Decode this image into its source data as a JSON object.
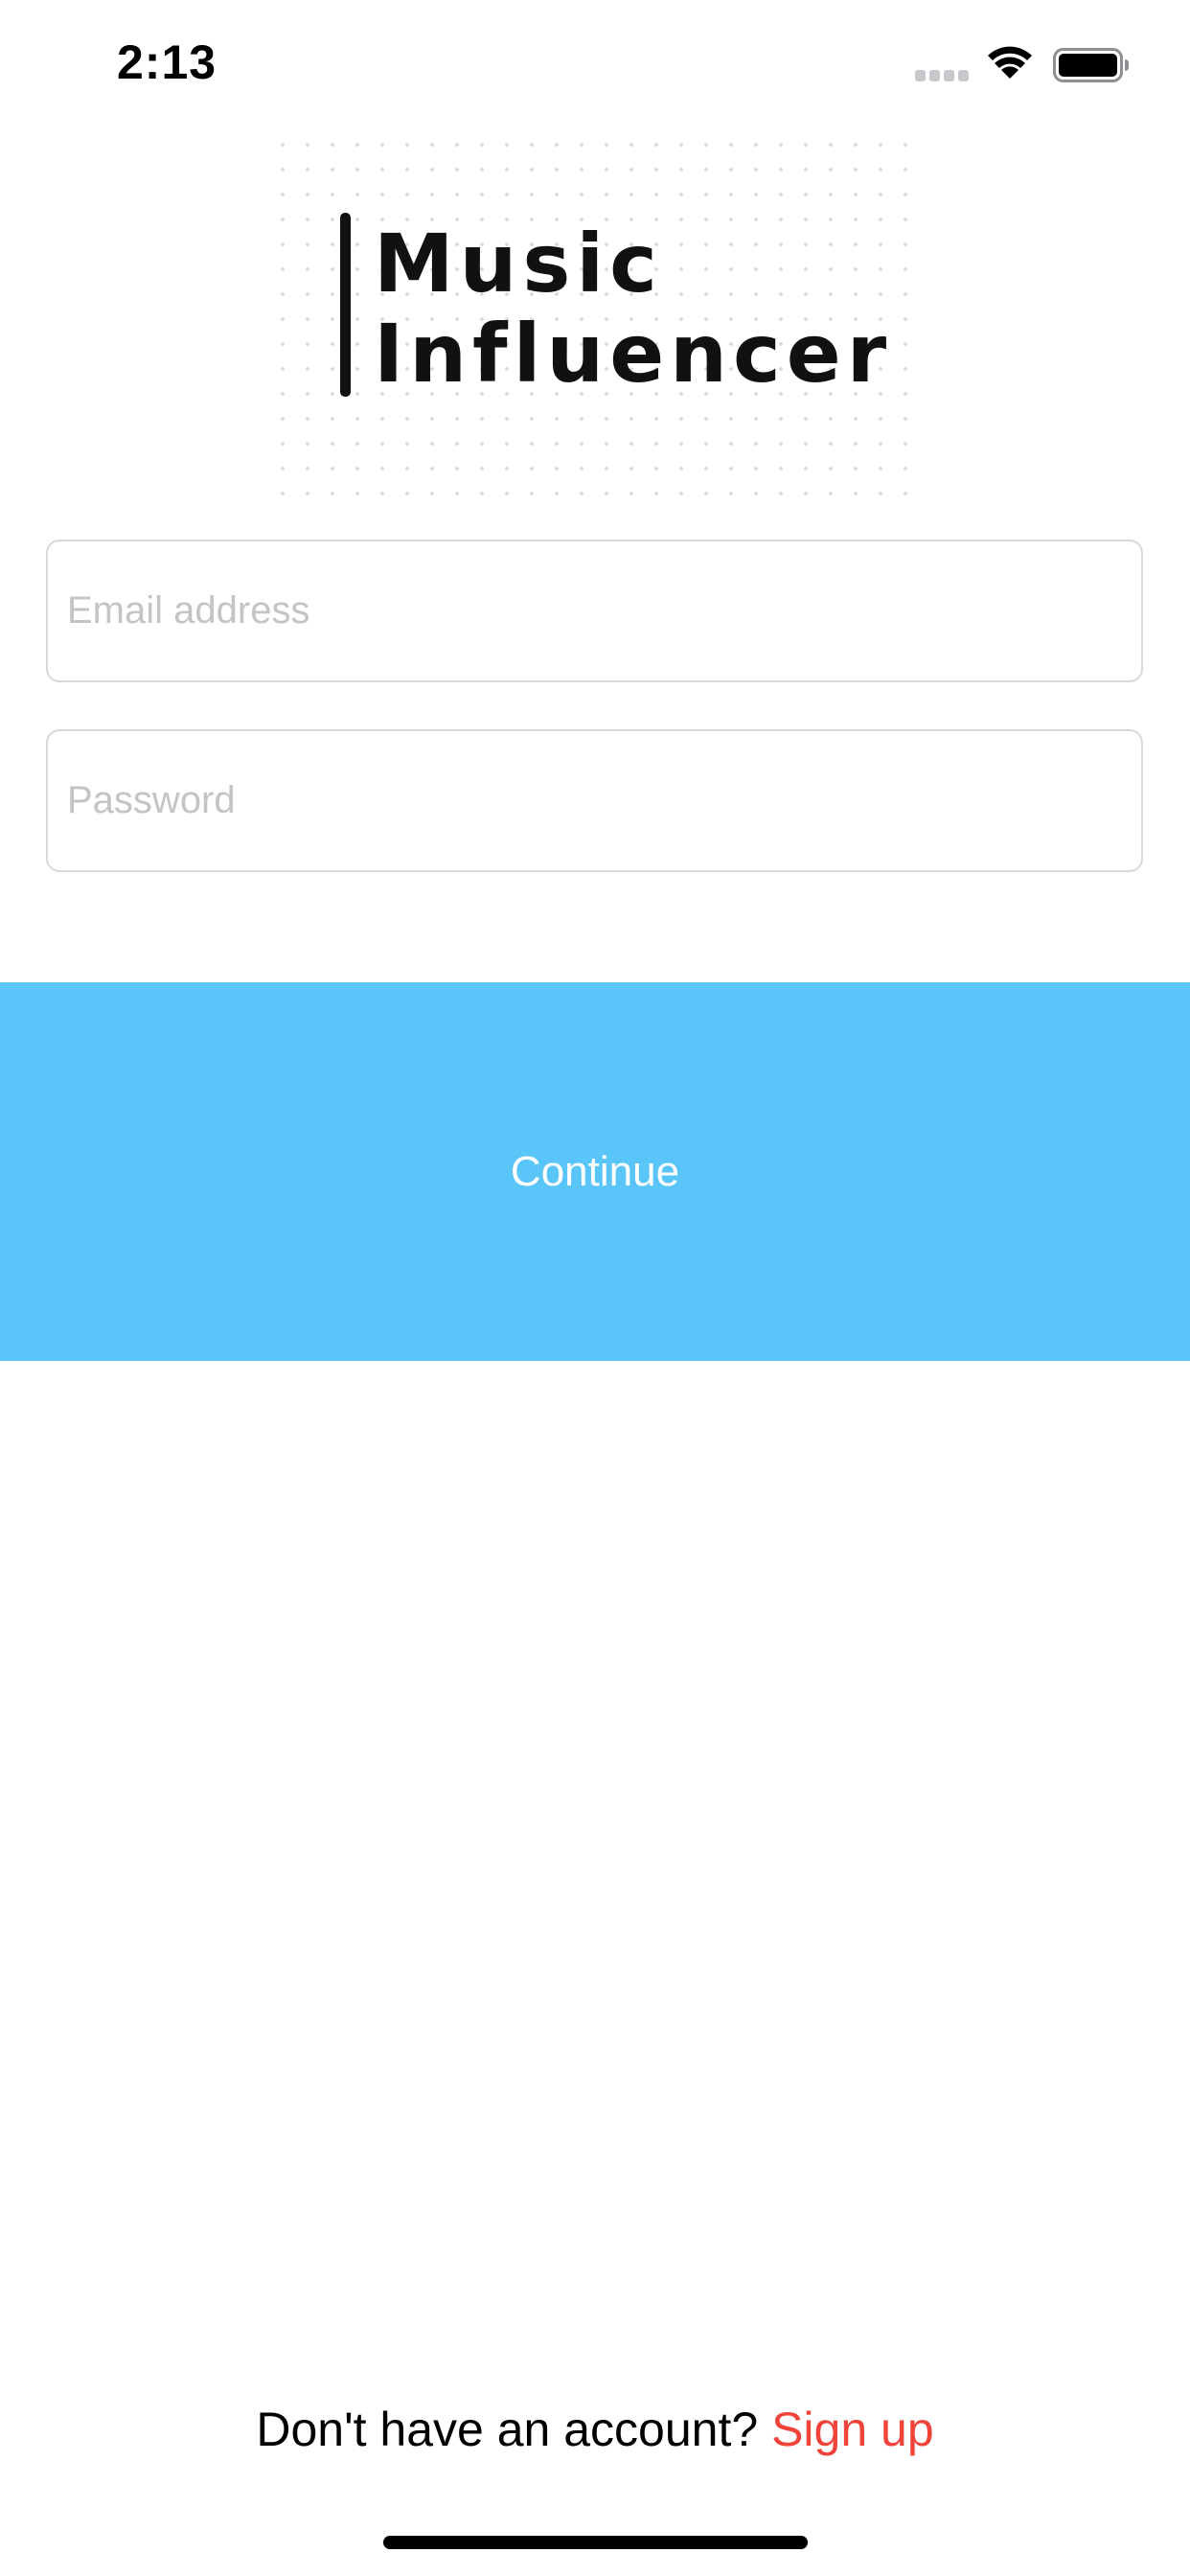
{
  "status_bar": {
    "time": "2:13",
    "icons": [
      "signal-dots-icon",
      "wifi-icon",
      "battery-icon"
    ]
  },
  "logo": {
    "line1": "Music",
    "line2": "Influencer"
  },
  "form": {
    "email_placeholder": "Email address",
    "email_value": "",
    "password_placeholder": "Password",
    "password_value": ""
  },
  "continue_button": {
    "label": "Continue",
    "background_color": "#5ac5f8"
  },
  "footer": {
    "prompt": "Don't have an account?",
    "signup_label": "Sign up",
    "signup_color": "#f0443a"
  }
}
